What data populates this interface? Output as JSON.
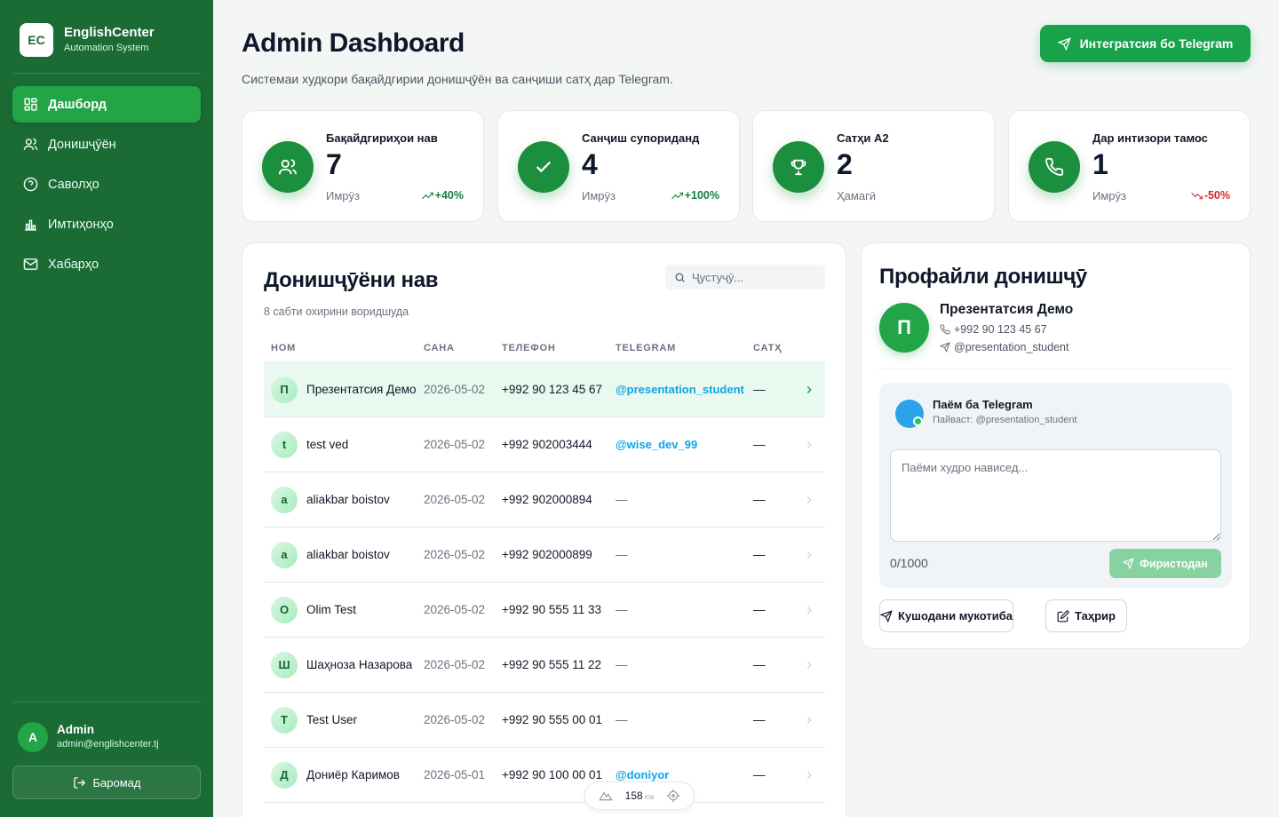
{
  "colors": {
    "sidebar": "#1b6b35",
    "accent": "#18a24a",
    "trend_up": "#15803d",
    "trend_down": "#dc2626",
    "link": "#0ea5e9"
  },
  "brand": {
    "logo": "EC",
    "name": "EnglishCenter",
    "subtitle": "Automation System"
  },
  "nav": [
    {
      "label": "Дашборд",
      "icon": "dashboard-icon",
      "active": true
    },
    {
      "label": "Донишҷӯён",
      "icon": "users-icon",
      "active": false
    },
    {
      "label": "Саволҳо",
      "icon": "question-icon",
      "active": false
    },
    {
      "label": "Имтиҳонҳо",
      "icon": "bar-chart-icon",
      "active": false
    },
    {
      "label": "Хабарҳо",
      "icon": "mail-icon",
      "active": false
    }
  ],
  "user": {
    "initial": "A",
    "name": "Admin",
    "email": "admin@englishcenter.tj",
    "logout_label": "Баромад"
  },
  "header": {
    "title": "Admin Dashboard",
    "subtitle": "Системаи худкори бақайдгирии донишҷӯён ва санҷиши сатҳ дар Telegram.",
    "telegram_button": "Интегратсия бо Telegram"
  },
  "stats": [
    {
      "label": "Бақайдгириҳои нав",
      "value": "7",
      "period": "Имрӯз",
      "trend": "+40%",
      "direction": "up",
      "icon": "users-icon"
    },
    {
      "label": "Санҷиш супориданд",
      "value": "4",
      "period": "Имрӯз",
      "trend": "+100%",
      "direction": "up",
      "icon": "check-icon"
    },
    {
      "label": "Сатҳи A2",
      "value": "2",
      "period": "Ҳамагӣ",
      "trend": "",
      "direction": "none",
      "icon": "trophy-icon"
    },
    {
      "label": "Дар интизори тамос",
      "value": "1",
      "period": "Имрӯз",
      "trend": "-50%",
      "direction": "down",
      "icon": "phone-icon"
    }
  ],
  "students": {
    "title": "Донишҷӯёни нав",
    "subtitle": "8 сабти охирини воридшуда",
    "search_placeholder": "Ҷустуҷӯ...",
    "columns": [
      "НОМ",
      "САНА",
      "ТЕЛЕФОН",
      "TELEGRAM",
      "САТҲ"
    ],
    "rows": [
      {
        "initial": "П",
        "name": "Презентатсия Демо",
        "date": "2026-05-02",
        "phone": "+992 90 123 45 67",
        "telegram": "@presentation_student",
        "level": "—",
        "selected": true
      },
      {
        "initial": "t",
        "name": "test ved",
        "date": "2026-05-02",
        "phone": "+992 902003444",
        "telegram": "@wise_dev_99",
        "level": "—",
        "selected": false
      },
      {
        "initial": "a",
        "name": "aliakbar boistov",
        "date": "2026-05-02",
        "phone": "+992 902000894",
        "telegram": "—",
        "level": "—",
        "selected": false
      },
      {
        "initial": "a",
        "name": "aliakbar boistov",
        "date": "2026-05-02",
        "phone": "+992 902000899",
        "telegram": "—",
        "level": "—",
        "selected": false
      },
      {
        "initial": "O",
        "name": "Olim Test",
        "date": "2026-05-02",
        "phone": "+992 90 555 11 33",
        "telegram": "—",
        "level": "—",
        "selected": false
      },
      {
        "initial": "Ш",
        "name": "Шаҳноза Назарова",
        "date": "2026-05-02",
        "phone": "+992 90 555 11 22",
        "telegram": "—",
        "level": "—",
        "selected": false
      },
      {
        "initial": "T",
        "name": "Test User",
        "date": "2026-05-02",
        "phone": "+992 90 555 00 01",
        "telegram": "—",
        "level": "—",
        "selected": false
      },
      {
        "initial": "Д",
        "name": "Дониёр Каримов",
        "date": "2026-05-01",
        "phone": "+992 90 100 00 01",
        "telegram": "@doniyor",
        "level": "—",
        "selected": false
      }
    ]
  },
  "perf": {
    "value": "158",
    "unit": "ms"
  },
  "profile": {
    "title": "Профайли донишҷӯ",
    "initial": "П",
    "name": "Презентатсия Демо",
    "phone": "+992 90 123 45 67",
    "telegram": "@presentation_student",
    "message": {
      "title": "Паём ба Telegram",
      "recipient": "Пайваст: @presentation_student",
      "placeholder": "Паёми худро нависед...",
      "counter": "0/1000",
      "send_label": "Фиристодан"
    },
    "actions": {
      "open_chat": "Кушодани мукотиба",
      "edit": "Таҳрир"
    }
  }
}
